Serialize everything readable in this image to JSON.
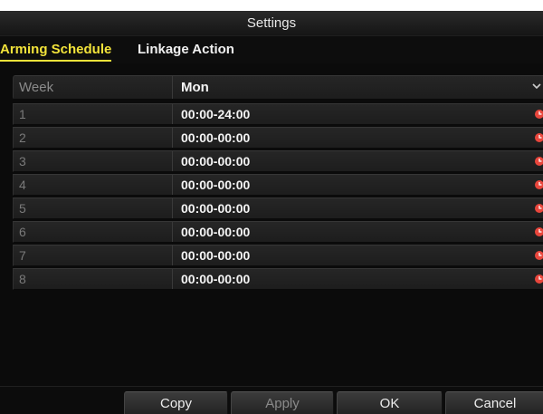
{
  "window": {
    "title": "Settings"
  },
  "tabs": [
    {
      "label": "Arming Schedule",
      "active": true
    },
    {
      "label": "Linkage Action",
      "active": false
    }
  ],
  "schedule": {
    "header_label": "Week",
    "selected_day": "Mon",
    "rows": [
      {
        "index": "1",
        "time": "00:00-24:00"
      },
      {
        "index": "2",
        "time": "00:00-00:00"
      },
      {
        "index": "3",
        "time": "00:00-00:00"
      },
      {
        "index": "4",
        "time": "00:00-00:00"
      },
      {
        "index": "5",
        "time": "00:00-00:00"
      },
      {
        "index": "6",
        "time": "00:00-00:00"
      },
      {
        "index": "7",
        "time": "00:00-00:00"
      },
      {
        "index": "8",
        "time": "00:00-00:00"
      }
    ]
  },
  "buttons": {
    "copy": "Copy",
    "apply": "Apply",
    "ok": "OK",
    "cancel": "Cancel"
  },
  "icons": {
    "row_action": "clock-icon",
    "dropdown": "chevron-down-icon"
  },
  "colors": {
    "accent": "#f2e33a",
    "clock": "#e8463c",
    "background": "#0b0b0b"
  }
}
